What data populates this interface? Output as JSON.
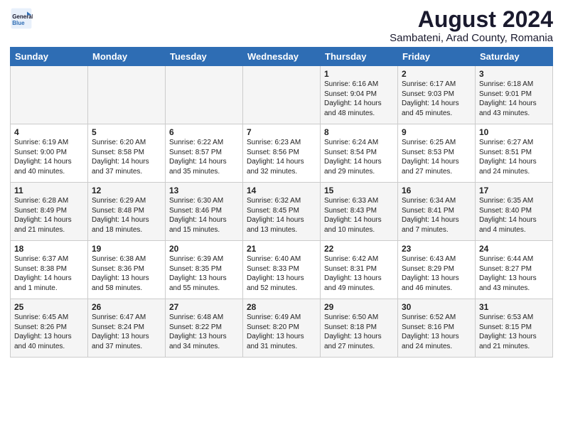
{
  "logo": {
    "line1": "General",
    "line2": "Blue"
  },
  "title": "August 2024",
  "subtitle": "Sambateni, Arad County, Romania",
  "headers": [
    "Sunday",
    "Monday",
    "Tuesday",
    "Wednesday",
    "Thursday",
    "Friday",
    "Saturday"
  ],
  "weeks": [
    [
      {
        "day": "",
        "info": ""
      },
      {
        "day": "",
        "info": ""
      },
      {
        "day": "",
        "info": ""
      },
      {
        "day": "",
        "info": ""
      },
      {
        "day": "1",
        "info": "Sunrise: 6:16 AM\nSunset: 9:04 PM\nDaylight: 14 hours\nand 48 minutes."
      },
      {
        "day": "2",
        "info": "Sunrise: 6:17 AM\nSunset: 9:03 PM\nDaylight: 14 hours\nand 45 minutes."
      },
      {
        "day": "3",
        "info": "Sunrise: 6:18 AM\nSunset: 9:01 PM\nDaylight: 14 hours\nand 43 minutes."
      }
    ],
    [
      {
        "day": "4",
        "info": "Sunrise: 6:19 AM\nSunset: 9:00 PM\nDaylight: 14 hours\nand 40 minutes."
      },
      {
        "day": "5",
        "info": "Sunrise: 6:20 AM\nSunset: 8:58 PM\nDaylight: 14 hours\nand 37 minutes."
      },
      {
        "day": "6",
        "info": "Sunrise: 6:22 AM\nSunset: 8:57 PM\nDaylight: 14 hours\nand 35 minutes."
      },
      {
        "day": "7",
        "info": "Sunrise: 6:23 AM\nSunset: 8:56 PM\nDaylight: 14 hours\nand 32 minutes."
      },
      {
        "day": "8",
        "info": "Sunrise: 6:24 AM\nSunset: 8:54 PM\nDaylight: 14 hours\nand 29 minutes."
      },
      {
        "day": "9",
        "info": "Sunrise: 6:25 AM\nSunset: 8:53 PM\nDaylight: 14 hours\nand 27 minutes."
      },
      {
        "day": "10",
        "info": "Sunrise: 6:27 AM\nSunset: 8:51 PM\nDaylight: 14 hours\nand 24 minutes."
      }
    ],
    [
      {
        "day": "11",
        "info": "Sunrise: 6:28 AM\nSunset: 8:49 PM\nDaylight: 14 hours\nand 21 minutes."
      },
      {
        "day": "12",
        "info": "Sunrise: 6:29 AM\nSunset: 8:48 PM\nDaylight: 14 hours\nand 18 minutes."
      },
      {
        "day": "13",
        "info": "Sunrise: 6:30 AM\nSunset: 8:46 PM\nDaylight: 14 hours\nand 15 minutes."
      },
      {
        "day": "14",
        "info": "Sunrise: 6:32 AM\nSunset: 8:45 PM\nDaylight: 14 hours\nand 13 minutes."
      },
      {
        "day": "15",
        "info": "Sunrise: 6:33 AM\nSunset: 8:43 PM\nDaylight: 14 hours\nand 10 minutes."
      },
      {
        "day": "16",
        "info": "Sunrise: 6:34 AM\nSunset: 8:41 PM\nDaylight: 14 hours\nand 7 minutes."
      },
      {
        "day": "17",
        "info": "Sunrise: 6:35 AM\nSunset: 8:40 PM\nDaylight: 14 hours\nand 4 minutes."
      }
    ],
    [
      {
        "day": "18",
        "info": "Sunrise: 6:37 AM\nSunset: 8:38 PM\nDaylight: 14 hours\nand 1 minute."
      },
      {
        "day": "19",
        "info": "Sunrise: 6:38 AM\nSunset: 8:36 PM\nDaylight: 13 hours\nand 58 minutes."
      },
      {
        "day": "20",
        "info": "Sunrise: 6:39 AM\nSunset: 8:35 PM\nDaylight: 13 hours\nand 55 minutes."
      },
      {
        "day": "21",
        "info": "Sunrise: 6:40 AM\nSunset: 8:33 PM\nDaylight: 13 hours\nand 52 minutes."
      },
      {
        "day": "22",
        "info": "Sunrise: 6:42 AM\nSunset: 8:31 PM\nDaylight: 13 hours\nand 49 minutes."
      },
      {
        "day": "23",
        "info": "Sunrise: 6:43 AM\nSunset: 8:29 PM\nDaylight: 13 hours\nand 46 minutes."
      },
      {
        "day": "24",
        "info": "Sunrise: 6:44 AM\nSunset: 8:27 PM\nDaylight: 13 hours\nand 43 minutes."
      }
    ],
    [
      {
        "day": "25",
        "info": "Sunrise: 6:45 AM\nSunset: 8:26 PM\nDaylight: 13 hours\nand 40 minutes."
      },
      {
        "day": "26",
        "info": "Sunrise: 6:47 AM\nSunset: 8:24 PM\nDaylight: 13 hours\nand 37 minutes."
      },
      {
        "day": "27",
        "info": "Sunrise: 6:48 AM\nSunset: 8:22 PM\nDaylight: 13 hours\nand 34 minutes."
      },
      {
        "day": "28",
        "info": "Sunrise: 6:49 AM\nSunset: 8:20 PM\nDaylight: 13 hours\nand 31 minutes."
      },
      {
        "day": "29",
        "info": "Sunrise: 6:50 AM\nSunset: 8:18 PM\nDaylight: 13 hours\nand 27 minutes."
      },
      {
        "day": "30",
        "info": "Sunrise: 6:52 AM\nSunset: 8:16 PM\nDaylight: 13 hours\nand 24 minutes."
      },
      {
        "day": "31",
        "info": "Sunrise: 6:53 AM\nSunset: 8:15 PM\nDaylight: 13 hours\nand 21 minutes."
      }
    ]
  ]
}
